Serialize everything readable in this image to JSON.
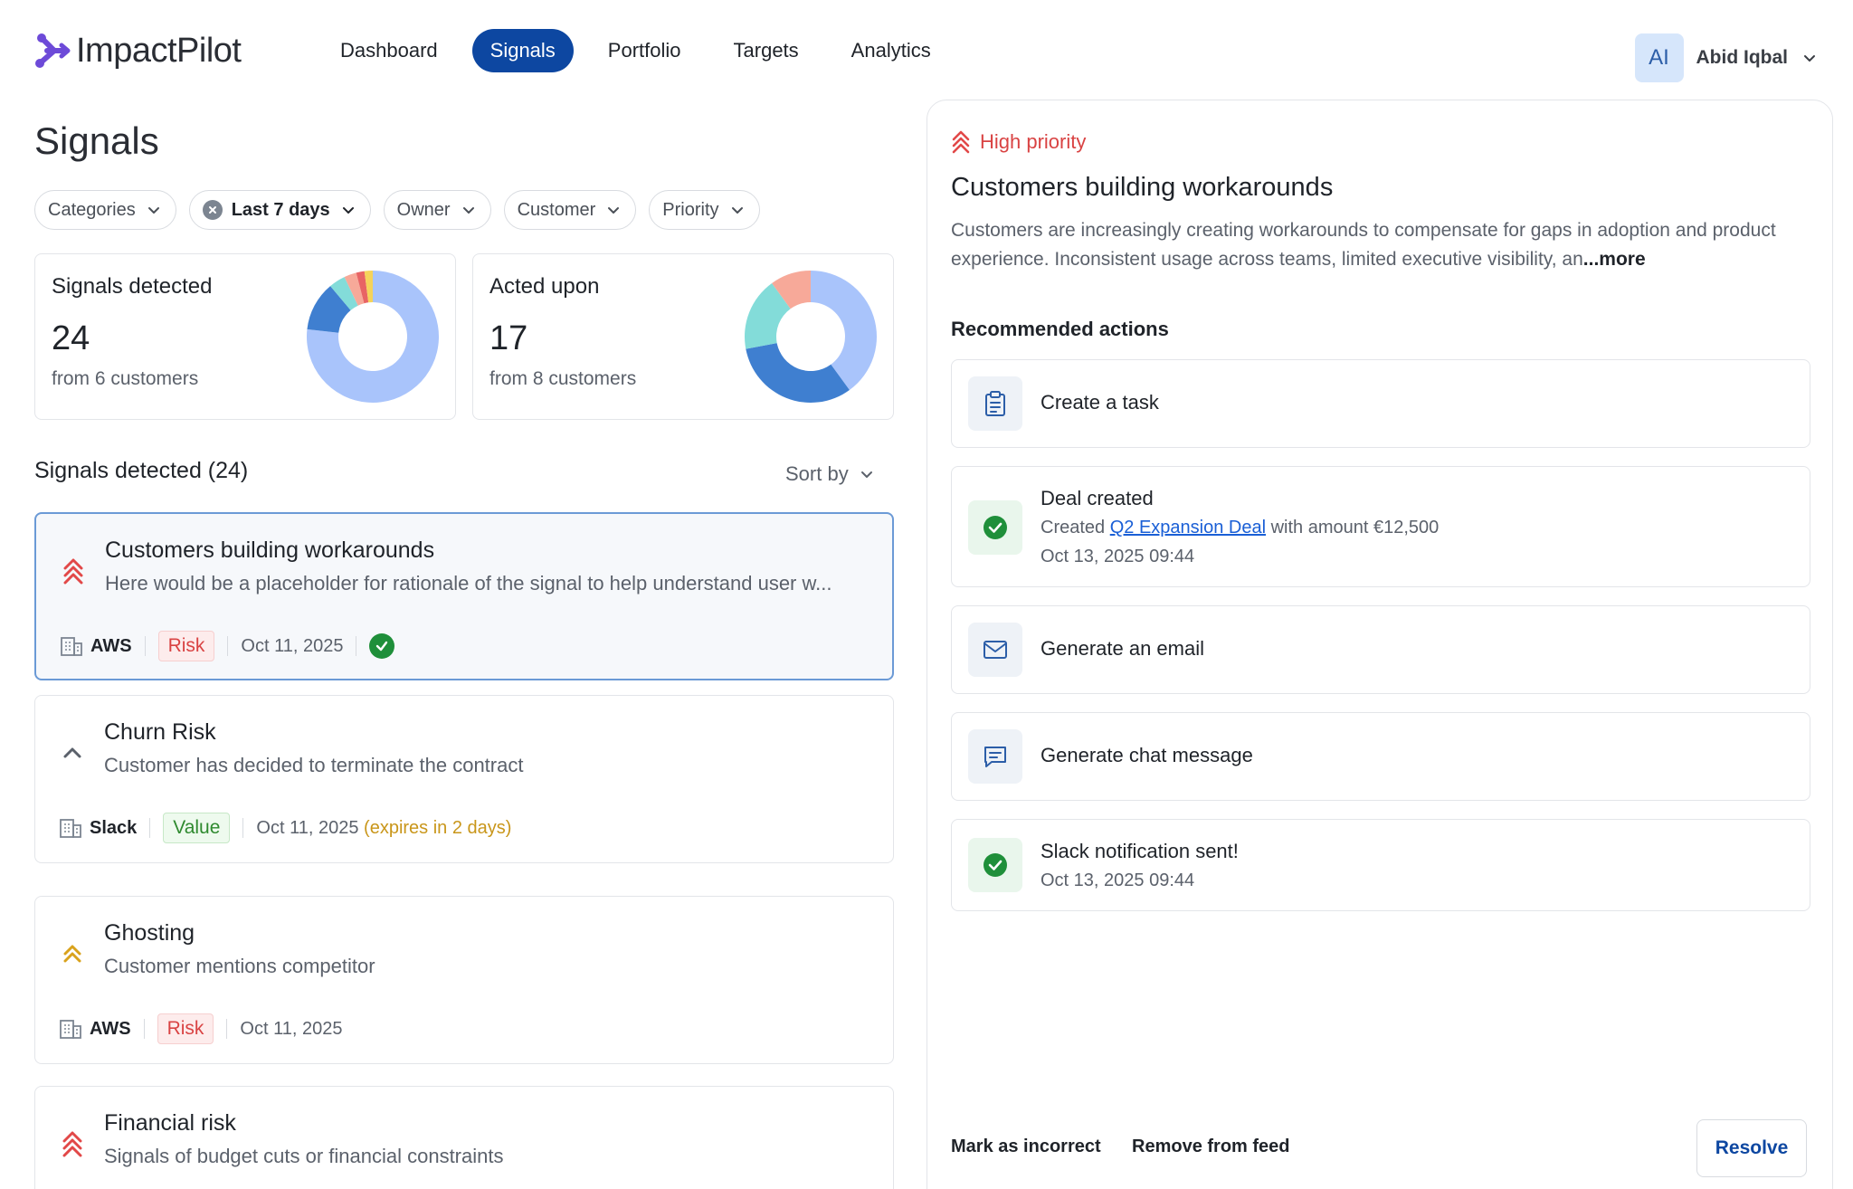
{
  "app": {
    "brand": "ImpactPilot"
  },
  "nav": [
    {
      "label": "Dashboard",
      "active": false
    },
    {
      "label": "Signals",
      "active": true
    },
    {
      "label": "Portfolio",
      "active": false
    },
    {
      "label": "Targets",
      "active": false
    },
    {
      "label": "Analytics",
      "active": false
    }
  ],
  "user": {
    "initials": "AI",
    "name": "Abid Iqbal"
  },
  "page": {
    "title": "Signals"
  },
  "filters": [
    {
      "label": "Categories",
      "active": false
    },
    {
      "label": "Last 7 days",
      "active": true
    },
    {
      "label": "Owner",
      "active": false
    },
    {
      "label": "Customer",
      "active": false
    },
    {
      "label": "Priority",
      "active": false
    }
  ],
  "stats": [
    {
      "title": "Signals detected",
      "value": "24",
      "sub": "from 6 customers",
      "donut": [
        {
          "value": 76,
          "color": "#a9c4fb"
        },
        {
          "value": 12,
          "color": "#3f7fd0"
        },
        {
          "value": 4,
          "color": "#83dcd9"
        },
        {
          "value": 3,
          "color": "#f7a999"
        },
        {
          "value": 2,
          "color": "#e86464"
        },
        {
          "value": 2,
          "color": "#f5d35a"
        }
      ]
    },
    {
      "title": "Acted upon",
      "value": "17",
      "sub": "from 8 customers",
      "donut": [
        {
          "value": 40,
          "color": "#a9c4fb"
        },
        {
          "value": 32,
          "color": "#3f7fd0"
        },
        {
          "value": 18,
          "color": "#83dcd9"
        },
        {
          "value": 10,
          "color": "#f7a999"
        }
      ]
    }
  ],
  "list": {
    "header": "Signals detected (24)",
    "sort_label": "Sort by"
  },
  "signals": [
    {
      "title": "Customers building workarounds",
      "desc": "Here would be a placeholder for rationale of the signal to help understand user w...",
      "company": "AWS",
      "tag": "Risk",
      "tag_type": "risk",
      "date": "Oct 11, 2025",
      "expires": "",
      "priority_icon": "double-chevron-up-icon",
      "icon_color": "#e24848",
      "done": true
    },
    {
      "title": "Churn Risk",
      "desc": "Customer has decided to terminate the contract",
      "company": "Slack",
      "tag": "Value",
      "tag_type": "value",
      "date": "Oct 11, 2025",
      "expires": "(expires in 2 days)",
      "priority_icon": "chevron-up-icon",
      "icon_color": "#5b616b",
      "done": false
    },
    {
      "title": "Ghosting",
      "desc": "Customer mentions competitor",
      "company": "AWS",
      "tag": "Risk",
      "tag_type": "risk",
      "date": "Oct 11, 2025",
      "expires": "",
      "priority_icon": "double-chevron-up-icon",
      "icon_color": "#d9a21c",
      "done": false
    },
    {
      "title": "Financial risk",
      "desc": "Signals of budget cuts or financial constraints",
      "company": "",
      "tag": "",
      "tag_type": "",
      "date": "",
      "expires": "",
      "priority_icon": "triple-chevron-up-icon",
      "icon_color": "#e24848",
      "done": false
    }
  ],
  "detail": {
    "priority": "High priority",
    "title": "Customers building workarounds",
    "desc": "Customers are increasingly creating workarounds to compensate for gaps in adoption and product experience. Inconsistent usage across teams, limited executive visibility, an",
    "more": "...more",
    "rec_title": "Recommended actions",
    "actions": [
      {
        "title": "Create a task",
        "icon": "clipboard-icon"
      },
      {
        "title": "Deal created",
        "sub_prefix": "Created ",
        "link": "Q2 Expansion Deal",
        "sub_suffix": " with amount €12,500",
        "time": "Oct 13, 2025 09:44",
        "icon": "check-circle-icon"
      },
      {
        "title": "Generate an email",
        "icon": "mail-icon"
      },
      {
        "title": "Generate chat message",
        "icon": "chat-icon"
      },
      {
        "title": "Slack notification sent!",
        "time": "Oct 13, 2025 09:44",
        "icon": "check-circle-icon"
      }
    ],
    "mark_incorrect": "Mark as incorrect",
    "remove_feed": "Remove from feed",
    "resolve": "Resolve"
  },
  "colors": {
    "accent": "#0d47a1",
    "risk": "#d94343",
    "value": "#2f8a2f",
    "warning": "#c9961a",
    "success": "#1f8f3a",
    "link": "#1a5fd6"
  }
}
